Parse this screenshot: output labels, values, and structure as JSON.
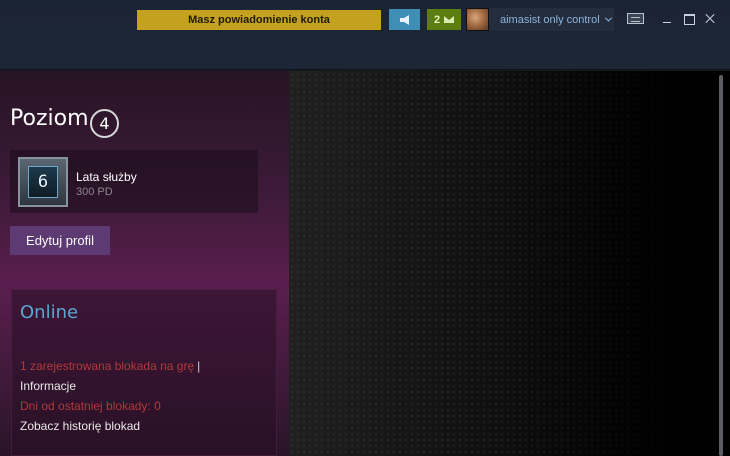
{
  "titlebar": {
    "notification": "Masz powiadomienie konta",
    "inbox_count": "2",
    "username": "aimasist only control",
    "icons": {
      "announce": "megaphone-icon",
      "inbox": "envelope-icon",
      "big_picture": "big-picture-icon",
      "minimize": "minimize-icon",
      "maximize": "maximize-icon",
      "close": "close-icon"
    },
    "colors": {
      "notification_bg": "#c4a11f",
      "announce_bg": "#3e8eb5",
      "inbox_bg": "#5c7e10"
    }
  },
  "profile": {
    "level_label": "Poziom",
    "level_value": "4",
    "badge": {
      "number": "6",
      "name": "Lata służby",
      "xp": "300 PD"
    },
    "edit_button": "Edytuj profil"
  },
  "status": {
    "state": "Online",
    "ban_text": "1 zarejestrowana blokada na grę",
    "ban_separator": "|",
    "info_link": "Informacje",
    "days_text": "Dni od ostatniej blokady: 0",
    "history_link": "Zobacz historię blokad",
    "colors": {
      "online": "#58a8d0",
      "ban": "#b03a3a"
    }
  }
}
